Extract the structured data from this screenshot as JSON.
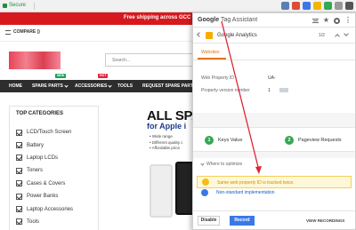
{
  "browser": {
    "secure_label": "Secure"
  },
  "site": {
    "promo_text": "Free shipping across GCC & India",
    "compare_label": "COMPARE ()",
    "nav": {
      "home": "HOME",
      "spare_parts": "SPARE PARTS",
      "accessories": "ACCESSORIES",
      "tools": "TOOLS",
      "request": "REQUEST SPARE PARTS",
      "badge_new": "NEW",
      "badge_hot": "HOT"
    },
    "categories_title": "TOP CATEGORIES",
    "categories": [
      "LCD/Touch Screen",
      "Battery",
      "Laptop LCDs",
      "Toners",
      "Cases & Covers",
      "Power Banks",
      "Laptop Accessories",
      "Tools"
    ],
    "hero": {
      "title": "ALL SPA",
      "subtitle": "for Apple i",
      "bullets": [
        "Wide range",
        "Different quality c",
        "Affordable price"
      ]
    }
  },
  "tag_assistant": {
    "title_prefix": "Google",
    "title_rest": " Tag Assistant",
    "tag_name": "Google Analytics",
    "page_indicator": "1/2",
    "tab": "Websites",
    "web_property_label": "Web Property ID",
    "web_property_value": "UA-",
    "property_version_label": "Property version number",
    "property_version_value": "1",
    "keys_count": "1",
    "keys_label": "Keys Value",
    "pageview_count": "2",
    "pageview_label": "Pageview Requests",
    "optimize_title": "Where to optimize",
    "issue_1": "Same web property ID is tracked twice.",
    "issue_2": "Non-standard implementation",
    "disable_label": "Disable",
    "record_label": "Record",
    "view_recordings_label": "VIEW RECORDINGS"
  }
}
